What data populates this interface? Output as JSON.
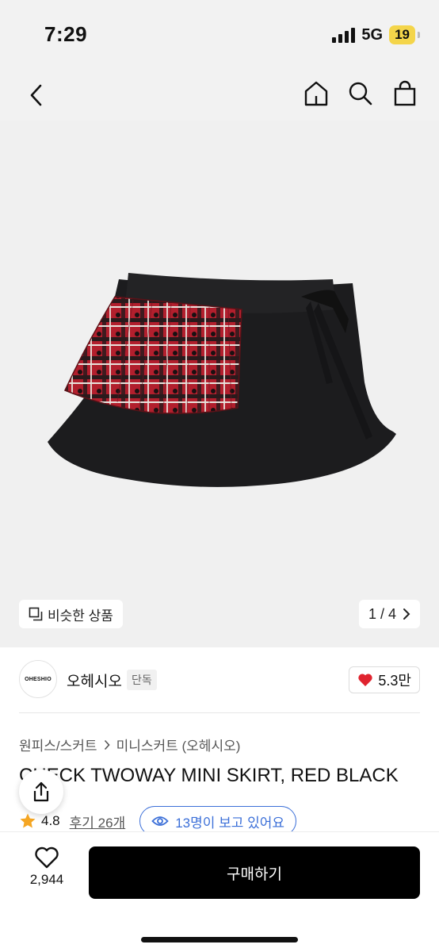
{
  "status_bar": {
    "time": "7:29",
    "network": "5G",
    "battery": "19"
  },
  "nav": {
    "icons": [
      "back-icon",
      "home-icon",
      "search-icon",
      "shopping-bag-icon"
    ]
  },
  "gallery": {
    "similar_label": "비슷한 상품",
    "counter": "1 / 4"
  },
  "brand": {
    "logo_text": "OHESHIO",
    "name": "오헤시오",
    "tag": "단독",
    "likes": "5.3만"
  },
  "breadcrumb": [
    "원피스/스커트",
    "미니스커트 (오헤시오)"
  ],
  "product": {
    "title": "CHECK TWOWAY MINI SKIRT, RED BLACK",
    "rating": "4.8",
    "reviews": "후기 26개",
    "viewers": "13명이 보고 있어요"
  },
  "bottom_bar": {
    "wish_count": "2,944",
    "buy_label": "구매하기"
  },
  "colors": {
    "accent_blue": "#3b6fd8",
    "heart_red": "#e0242f",
    "star": "#f5a623"
  }
}
